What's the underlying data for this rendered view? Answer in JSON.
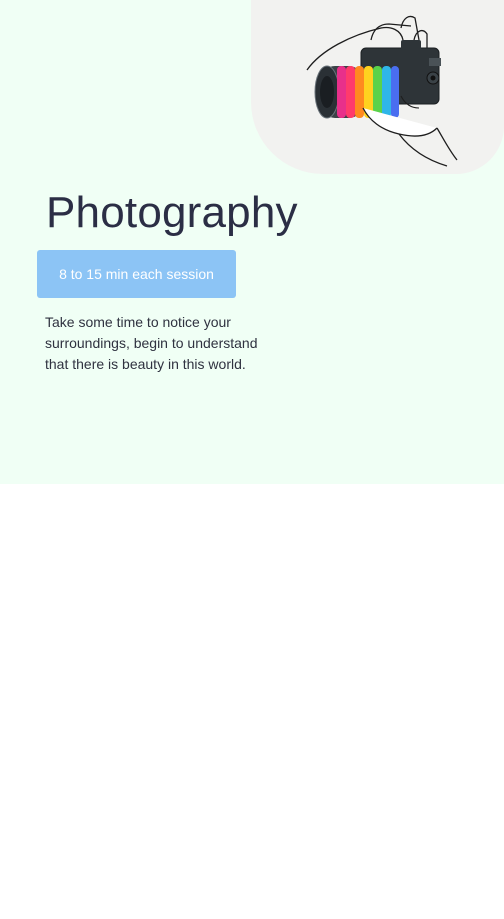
{
  "activity": {
    "title": "Photography",
    "session_label": "8 to 15 min each session",
    "description": "Take some time to notice your surroundings, begin to understand that there is beauty in this world."
  },
  "illustration": {
    "icon": "camera-icon",
    "subject": "hands holding a camera with a rainbow lens"
  },
  "colors": {
    "card_background": "#f0fff5",
    "badge_background": "#8cc4f5",
    "text": "#2b2e45",
    "lens_rainbow": [
      "#e8308a",
      "#ff3b6b",
      "#ff8a1f",
      "#ffd21f",
      "#5ad24a",
      "#2fb6e8",
      "#4a6ef0"
    ]
  }
}
